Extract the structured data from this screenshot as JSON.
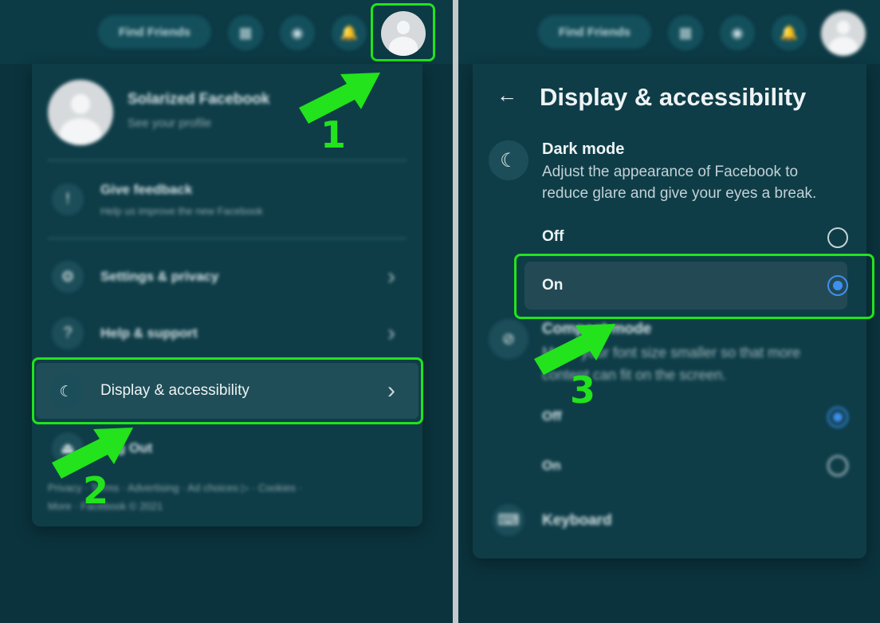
{
  "colors": {
    "highlight": "#22e31c",
    "background": "#0b333d",
    "radio_accent": "#3e8ff0"
  },
  "left": {
    "topbar": {
      "find_friends": "Find Friends",
      "icons": [
        "grid-icon",
        "messenger-icon",
        "bell-icon",
        "avatar"
      ]
    },
    "profile": {
      "name": "Solarized Facebook",
      "sub": "See your profile"
    },
    "feedback": {
      "label": "Give feedback",
      "sub": "Help us improve the new Facebook"
    },
    "items": [
      {
        "label": "Settings & privacy",
        "icon": "gear-icon"
      },
      {
        "label": "Help & support",
        "icon": "help-icon"
      },
      {
        "label": "Display & accessibility",
        "icon": "moon-icon"
      },
      {
        "label": "Log Out",
        "icon": "logout-icon"
      }
    ],
    "footer_line1": "Privacy · Terms · Advertising · Ad choices ▷ · Cookies ·",
    "footer_line2": "More · Facebook © 2021"
  },
  "right": {
    "topbar": {
      "find_friends": "Find Friends"
    },
    "back_icon": "←",
    "title": "Display & accessibility",
    "dark_mode": {
      "title": "Dark mode",
      "desc_line1": "Adjust the appearance of Facebook to",
      "desc_line2": "reduce glare and give your eyes a break.",
      "options": [
        {
          "label": "Off",
          "checked": false
        },
        {
          "label": "On",
          "checked": true
        }
      ]
    },
    "compact_mode": {
      "title": "Compact mode",
      "desc_line1": "Make your font size smaller so that more",
      "desc_line2": "content can fit on the screen.",
      "options": [
        {
          "label": "Off",
          "checked": true
        },
        {
          "label": "On",
          "checked": false
        }
      ]
    },
    "keyboard": {
      "label": "Keyboard"
    }
  },
  "steps": [
    "1",
    "2",
    "3"
  ]
}
